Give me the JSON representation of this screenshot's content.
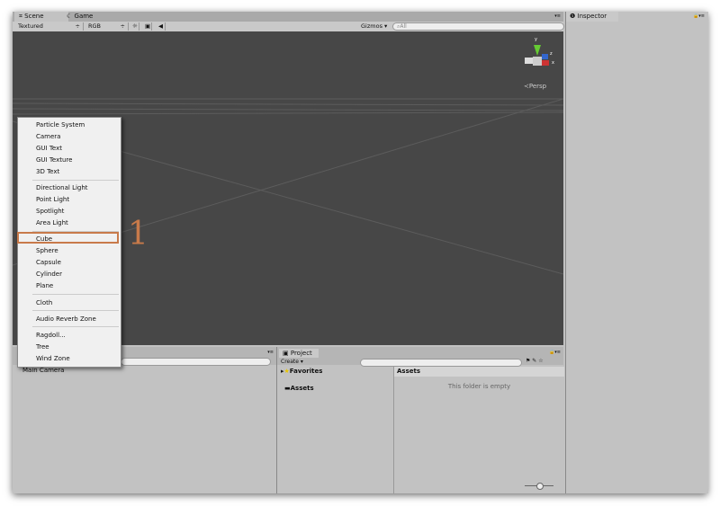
{
  "scene": {
    "tabs": [
      {
        "label": "Scene"
      },
      {
        "label": "Game"
      }
    ],
    "toolbar": {
      "shading": "Textured",
      "render": "RGB",
      "gizmos": "Gizmos",
      "search_placeholder": "All"
    },
    "gizmo": {
      "persp": "Persp",
      "y": "y",
      "z": "z",
      "x": "x"
    }
  },
  "inspector": {
    "title": "Inspector"
  },
  "hierarchy": {
    "items": [
      "Main Camera"
    ]
  },
  "project": {
    "title": "Project",
    "create": "Create",
    "favorites": "Favorites",
    "assets": "Assets",
    "assets_header": "Assets",
    "empty": "This folder is empty"
  },
  "menu": {
    "items": [
      "Particle System",
      "Camera",
      "GUI Text",
      "GUI Texture",
      "3D Text",
      "Directional Light",
      "Point Light",
      "Spotlight",
      "Area Light",
      "Cube",
      "Sphere",
      "Capsule",
      "Cylinder",
      "Plane",
      "Cloth",
      "Audio Reverb Zone",
      "Ragdoll...",
      "Tree",
      "Wind Zone"
    ]
  },
  "annotation": {
    "label": "1",
    "color": "#c87a4a"
  }
}
